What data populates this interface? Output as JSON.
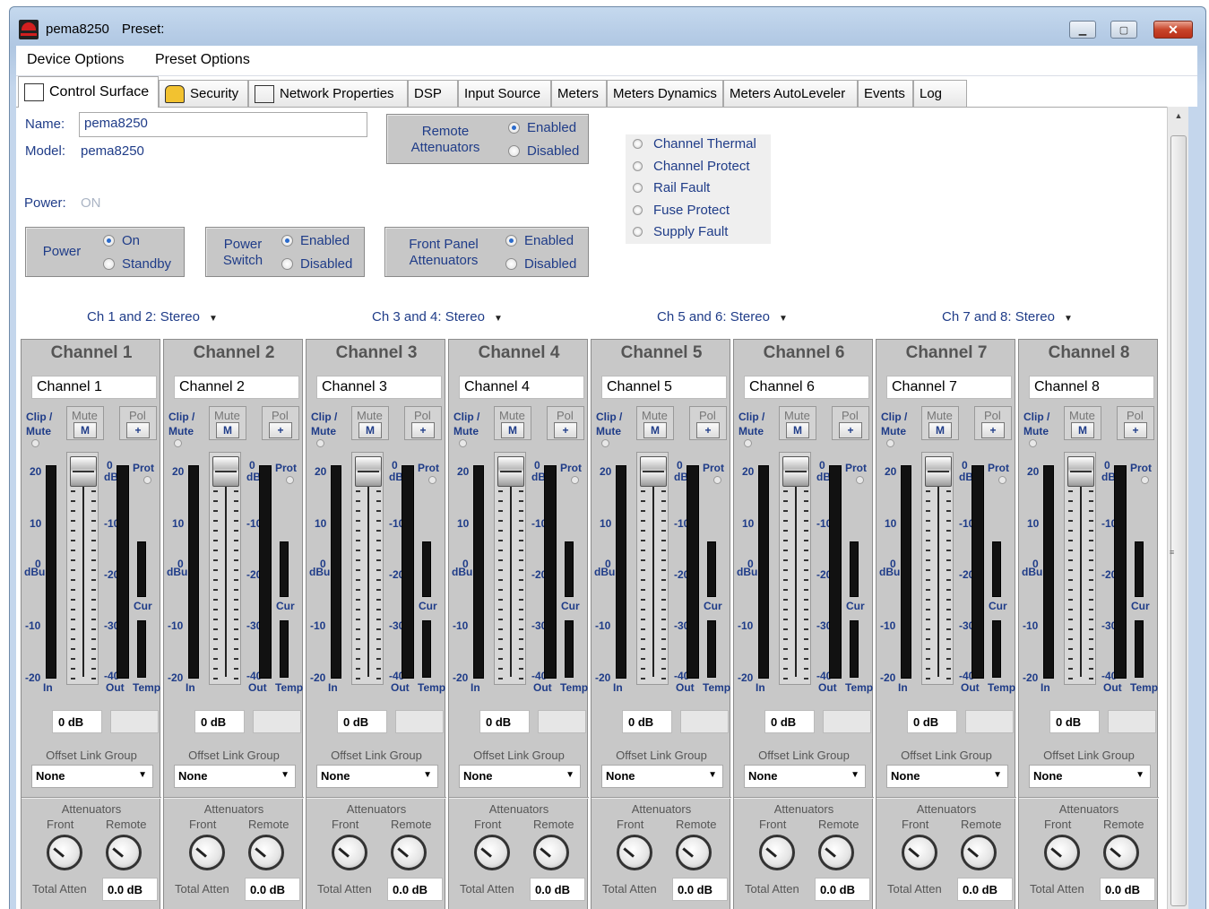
{
  "window": {
    "app_name": "pema8250",
    "preset_label": "Preset:"
  },
  "menu": [
    "Device Options",
    "Preset Options"
  ],
  "tabs": [
    "Control Surface",
    "Security",
    "Network Properties",
    "DSP",
    "Input Source",
    "Meters",
    "Meters Dynamics",
    "Meters AutoLeveler",
    "Events",
    "Log"
  ],
  "device": {
    "name_label": "Name:",
    "name_value": "pema8250",
    "model_label": "Model:",
    "model_value": "pema8250",
    "power_label": "Power:",
    "power_value": "ON"
  },
  "remote_attenuators": {
    "label": "Remote\nAttenuators",
    "options": [
      "Enabled",
      "Disabled"
    ],
    "selected": "Enabled"
  },
  "power": {
    "label": "Power",
    "options": [
      "On",
      "Standby"
    ],
    "selected": "On"
  },
  "power_switch": {
    "label": "Power\nSwitch",
    "options": [
      "Enabled",
      "Disabled"
    ],
    "selected": "Enabled"
  },
  "front_panel": {
    "label": "Front Panel\nAttenuators",
    "options": [
      "Enabled",
      "Disabled"
    ],
    "selected": "Enabled"
  },
  "status_indicators": [
    "Channel Thermal",
    "Channel Protect",
    "Rail Fault",
    "Fuse Protect",
    "Supply Fault"
  ],
  "channel_pairs": [
    {
      "label": "Ch 1 and 2:",
      "mode": "Stereo"
    },
    {
      "label": "Ch 3 and 4:",
      "mode": "Stereo"
    },
    {
      "label": "Ch 5 and 6:",
      "mode": "Stereo"
    },
    {
      "label": "Ch 7 and 8:",
      "mode": "Stereo"
    }
  ],
  "channels": [
    {
      "title": "Channel 1",
      "name": "Channel 1",
      "gain": "0 dB",
      "offset_group": "None",
      "total_atten": "0.0 dB"
    },
    {
      "title": "Channel 2",
      "name": "Channel 2",
      "gain": "0 dB",
      "offset_group": "None",
      "total_atten": "0.0 dB"
    },
    {
      "title": "Channel 3",
      "name": "Channel 3",
      "gain": "0 dB",
      "offset_group": "None",
      "total_atten": "0.0 dB"
    },
    {
      "title": "Channel 4",
      "name": "Channel 4",
      "gain": "0 dB",
      "offset_group": "None",
      "total_atten": "0.0 dB"
    },
    {
      "title": "Channel 5",
      "name": "Channel 5",
      "gain": "0 dB",
      "offset_group": "None",
      "total_atten": "0.0 dB"
    },
    {
      "title": "Channel 6",
      "name": "Channel 6",
      "gain": "0 dB",
      "offset_group": "None",
      "total_atten": "0.0 dB"
    },
    {
      "title": "Channel 7",
      "name": "Channel 7",
      "gain": "0 dB",
      "offset_group": "None",
      "total_atten": "0.0 dB"
    },
    {
      "title": "Channel 8",
      "name": "Channel 8",
      "gain": "0 dB",
      "offset_group": "None",
      "total_atten": "0.0 dB"
    }
  ],
  "strip_labels": {
    "clip_mute": "Clip /\nMute",
    "mute": "Mute",
    "mute_btn": "M",
    "pol": "Pol",
    "pol_btn": "+",
    "prot": "Prot",
    "in_scale": [
      "20",
      "10",
      "0",
      "-10",
      "-20"
    ],
    "dbu": "dBu",
    "in": "In",
    "out_scale": [
      "0",
      "-10",
      "-20",
      "-30",
      "-40"
    ],
    "db": "dB",
    "cur": "Cur",
    "out": "Out",
    "temp": "Temp",
    "offset_link_group": "Offset Link Group",
    "attenuators": "Attenuators",
    "front": "Front",
    "remote": "Remote",
    "total_atten": "Total Atten"
  }
}
